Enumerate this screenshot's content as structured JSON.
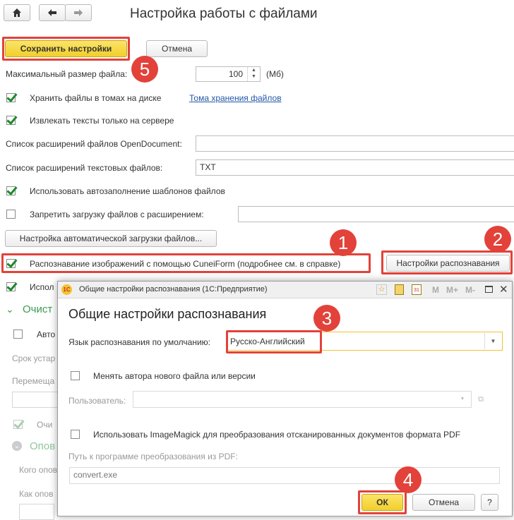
{
  "toolbar": {
    "home_icon": "home-icon",
    "back_icon": "arrow-left-icon",
    "forward_icon": "arrow-right-icon"
  },
  "page": {
    "title": "Настройка работы с файлами"
  },
  "buttons": {
    "save": "Сохранить настройки",
    "cancel": "Отмена",
    "autoload": "Настройка автоматической загрузки файлов...",
    "recognition_settings": "Настройки распознавания"
  },
  "form": {
    "max_size_label": "Максимальный размер файла:",
    "max_size_value": "100",
    "max_size_unit": "(Мб)",
    "store_volumes_label": "Хранить файлы в томах на диске",
    "volumes_link": "Тома хранения файлов",
    "extract_server_label": "Извлекать тексты только на сервере",
    "odf_label": "Список расширений файлов OpenDocument:",
    "odf_value": "",
    "text_ext_label": "Список расширений текстовых файлов:",
    "text_ext_value": "TXT",
    "autofill_label": "Использовать автозаполнение шаблонов файлов",
    "forbid_label": "Запретить загрузку файлов с расширением:",
    "cuneiform_label": "Распознавание изображений с помощью CuneiForm (подробнее см. в справке)",
    "use_partial": "Испол",
    "cleanup_partial": "Очист",
    "auto_partial": "Авто",
    "period_partial": "Срок устар",
    "move_partial": "Перемеща",
    "clean2_partial": "Очи",
    "notify_partial": "Опов",
    "whom_partial": "Кого опов",
    "how_partial": "Как опов"
  },
  "dialog": {
    "window_title": "Общие настройки распознавания  (1С:Предприятие)",
    "header_icons": [
      "star-icon",
      "calculator-icon",
      "calendar-icon"
    ],
    "mem_buttons": [
      "M",
      "M+",
      "M-"
    ],
    "heading": "Общие настройки распознавания",
    "lang_label": "Язык распознавания по умолчанию:",
    "lang_value": "Русско-Английский",
    "change_author_label": "Менять автора нового файла или версии",
    "user_label": "Пользователь:",
    "imagemagick_label": "Использовать ImageMagick для преобразования отсканированных документов формата PDF",
    "pdf_path_label": "Путь к программе преобразования из PDF:",
    "pdf_path_value": "convert.exe",
    "ok": "ОК",
    "cancel": "Отмена",
    "help": "?"
  },
  "badges": {
    "b1": "1",
    "b2": "2",
    "b3": "3",
    "b4": "4",
    "b5": "5"
  },
  "colors": {
    "accent_red": "#e2423a",
    "save_yellow": "#f5d63c",
    "dialog_yellow": "#f7c731",
    "check_green": "#1c8a2a",
    "link_blue": "#2457a8"
  }
}
